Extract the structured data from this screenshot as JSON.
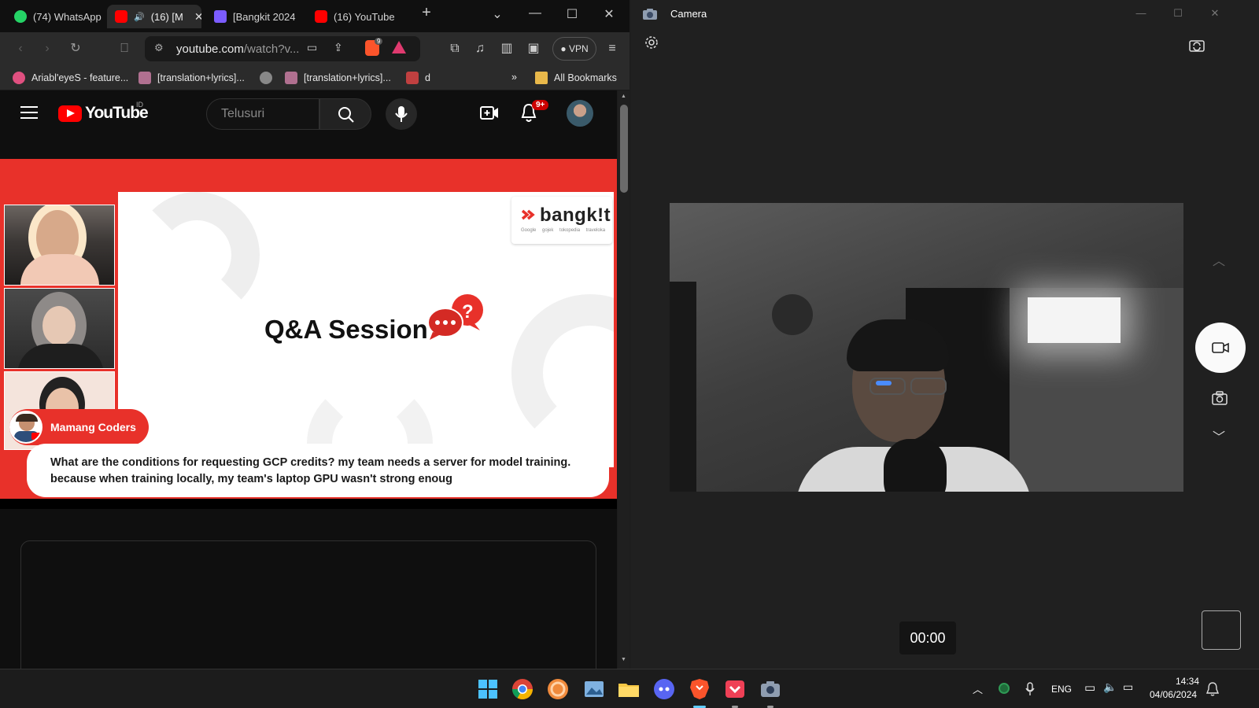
{
  "browser": {
    "tabs": [
      {
        "label": "(74) WhatsApp",
        "color": "#25d366",
        "active": false
      },
      {
        "label": "(16) [M",
        "color": "#ff0000",
        "active": true
      },
      {
        "label": "[Bangkit 2024",
        "color": "#7b5cff",
        "active": false
      },
      {
        "label": "(16) YouTube",
        "color": "#ff0000",
        "active": false
      }
    ],
    "url_host": "youtube.com",
    "url_path": "/watch?v...",
    "shields_count": "9",
    "vpn_label": "VPN",
    "bookmarks": [
      {
        "label": "Ariabl'eyeS - feature..."
      },
      {
        "label": "[translation+lyrics]..."
      },
      {
        "label": "[translation+lyrics]..."
      },
      {
        "label": "d"
      }
    ],
    "bookmarks_overflow": "»",
    "all_bookmarks": "All Bookmarks"
  },
  "youtube": {
    "logo_text": "YouTube",
    "country_code": "ID",
    "search_placeholder": "Telusuri",
    "notification_count": "9+",
    "accent": "#ff0000"
  },
  "video": {
    "brand": "bangk!t",
    "brand_partners": "Google gojek tokopedia traveloka",
    "slide_title": "Q&A Session",
    "speaker_name": "Mamang Coders",
    "question": "What are the conditions for requesting GCP credits? my team needs a server for model training. because when training locally, my team's laptop GPU wasn't strong enoug",
    "slide_color": "#e8312a"
  },
  "camera": {
    "title": "Camera",
    "timer": "00:00"
  },
  "taskbar": {
    "language": "ENG",
    "time": "14:34",
    "date": "04/06/2024",
    "apps": [
      "windows-start",
      "chrome",
      "firefox-nightly",
      "photos",
      "file-explorer",
      "discord",
      "brave",
      "pocket",
      "camera"
    ]
  }
}
